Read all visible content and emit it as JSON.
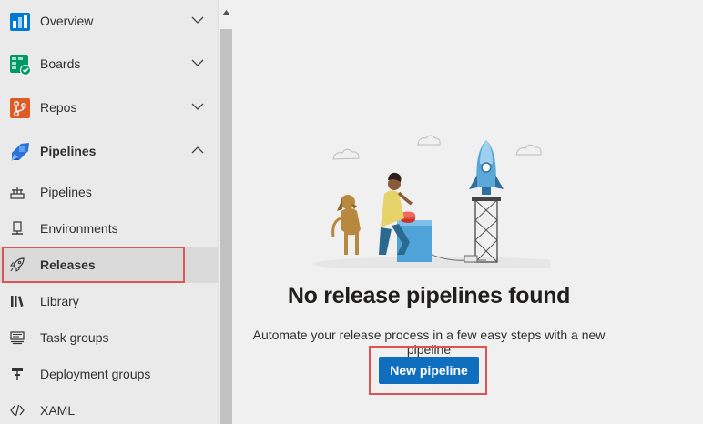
{
  "sidebar": {
    "sections": [
      {
        "label": "Overview",
        "icon": "overview-icon",
        "state": "collapsed"
      },
      {
        "label": "Boards",
        "icon": "boards-icon",
        "state": "collapsed"
      },
      {
        "label": "Repos",
        "icon": "repos-icon",
        "state": "collapsed"
      },
      {
        "label": "Pipelines",
        "icon": "pipelines-icon",
        "state": "expanded"
      }
    ],
    "pipeline_items": [
      {
        "label": "Pipelines",
        "icon": "pipelines-item-icon"
      },
      {
        "label": "Environments",
        "icon": "environments-icon"
      },
      {
        "label": "Releases",
        "icon": "rocket-icon",
        "selected": true
      },
      {
        "label": "Library",
        "icon": "library-icon"
      },
      {
        "label": "Task groups",
        "icon": "task-groups-icon"
      },
      {
        "label": "Deployment groups",
        "icon": "deployment-groups-icon"
      },
      {
        "label": "XAML",
        "icon": "code-icon"
      }
    ]
  },
  "main": {
    "empty_title": "No release pipelines found",
    "empty_description": "Automate your release process in a few easy steps with a new pipeline",
    "new_pipeline_label": "New pipeline"
  },
  "colors": {
    "accent": "#106ebe",
    "highlight": "#e15252",
    "sidebar_bg": "#eaeaea",
    "selected_bg": "#dadada"
  }
}
